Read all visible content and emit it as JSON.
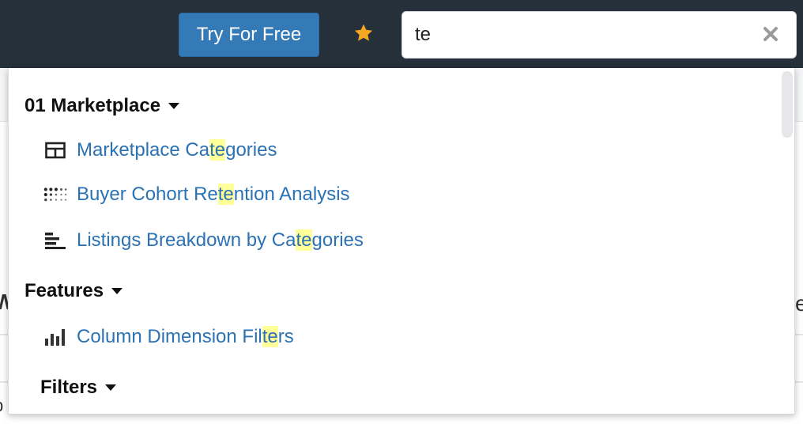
{
  "header": {
    "try_button": "Try For Free",
    "favorite_icon": "star-icon",
    "search": {
      "value": "te",
      "placeholder": ""
    },
    "clear_icon": "close-icon"
  },
  "background": {
    "edge_left": "W",
    "edge_right": "e",
    "edge_left_bottom": "p"
  },
  "dropdown": {
    "highlight_color": "#ffff99",
    "link_color": "#2b72b3",
    "groups": [
      {
        "title": "01 Marketplace",
        "items": [
          {
            "icon": "table-icon",
            "pre": "Marketplace Ca",
            "match": "te",
            "post": "gories"
          },
          {
            "icon": "dot-matrix-icon",
            "pre": "Buyer Cohort Re",
            "match": "te",
            "post": "ntion Analysis"
          },
          {
            "icon": "horizontal-bar-chart-icon",
            "pre": "Listings Breakdown by Ca",
            "match": "te",
            "post": "gories"
          }
        ]
      },
      {
        "title": "Features",
        "items": [
          {
            "icon": "column-chart-icon",
            "pre": "Column Dimension Fil",
            "match": "te",
            "post": "rs"
          }
        ]
      },
      {
        "title": "Filters",
        "items": []
      }
    ]
  }
}
